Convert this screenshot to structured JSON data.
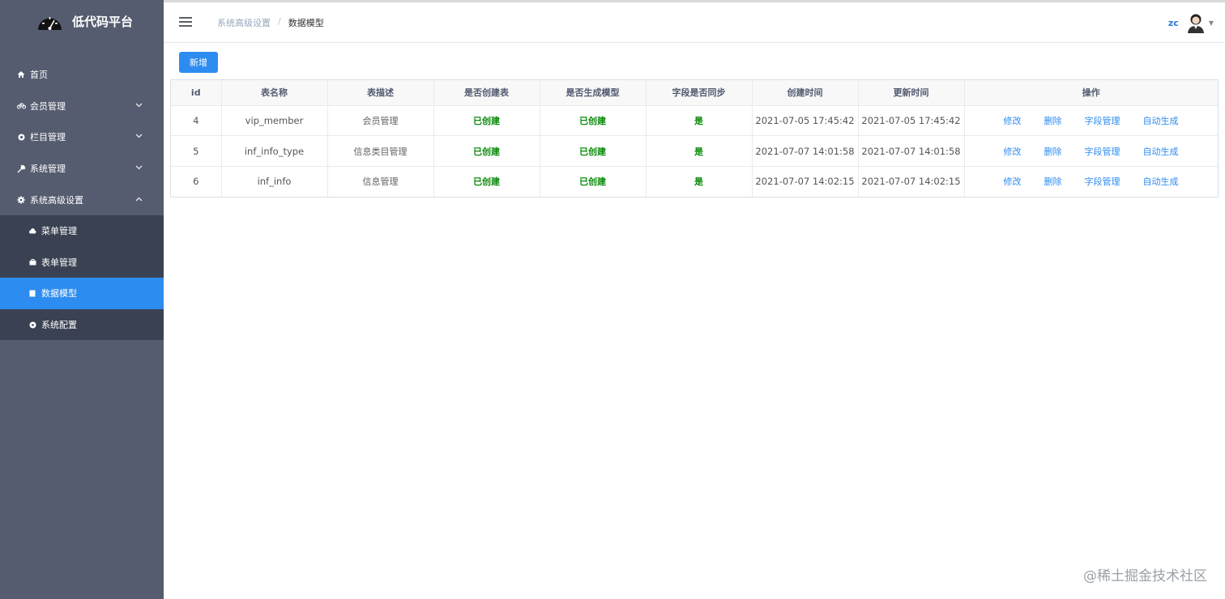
{
  "brand": {
    "title": "低代码平台"
  },
  "sidebar": {
    "items": [
      {
        "label": "首页",
        "icon": "home-icon"
      },
      {
        "label": "会员管理",
        "icon": "bicycle-icon"
      },
      {
        "label": "栏目管理",
        "icon": "dot-icon"
      },
      {
        "label": "系统管理",
        "icon": "tools-icon"
      },
      {
        "label": "系统高级设置",
        "icon": "gear-icon"
      }
    ],
    "subitems": [
      {
        "label": "菜单管理",
        "icon": "cloud-icon"
      },
      {
        "label": "表单管理",
        "icon": "briefcase-icon"
      },
      {
        "label": "数据模型",
        "icon": "document-icon",
        "active": true
      },
      {
        "label": "系统配置",
        "icon": "circle-icon"
      }
    ]
  },
  "header": {
    "breadcrumb": [
      "系统高级设置",
      "数据模型"
    ],
    "user": "zc"
  },
  "toolbar": {
    "add_label": "新增"
  },
  "table": {
    "columns": [
      "id",
      "表名称",
      "表描述",
      "是否创建表",
      "是否生成模型",
      "字段是否同步",
      "创建时间",
      "更新时间",
      "操作"
    ],
    "rows": [
      {
        "id": "4",
        "name": "vip_member",
        "desc": "会员管理",
        "created": "已创建",
        "model": "已创建",
        "sync": "是",
        "ctime": "2021-07-05 17:45:42",
        "utime": "2021-07-05 17:45:42"
      },
      {
        "id": "5",
        "name": "inf_info_type",
        "desc": "信息类目管理",
        "created": "已创建",
        "model": "已创建",
        "sync": "是",
        "ctime": "2021-07-07 14:01:58",
        "utime": "2021-07-07 14:01:58"
      },
      {
        "id": "6",
        "name": "inf_info",
        "desc": "信息管理",
        "created": "已创建",
        "model": "已创建",
        "sync": "是",
        "ctime": "2021-07-07 14:02:15",
        "utime": "2021-07-07 14:02:15"
      }
    ],
    "actions": [
      "修改",
      "删除",
      "字段管理",
      "自动生成"
    ]
  },
  "watermark": "@稀土掘金技术社区",
  "colors": {
    "sidebar": "#555c6f",
    "submenu": "#3a4152",
    "accent": "#2d8cf0",
    "status_green": "#0a8a0a"
  }
}
